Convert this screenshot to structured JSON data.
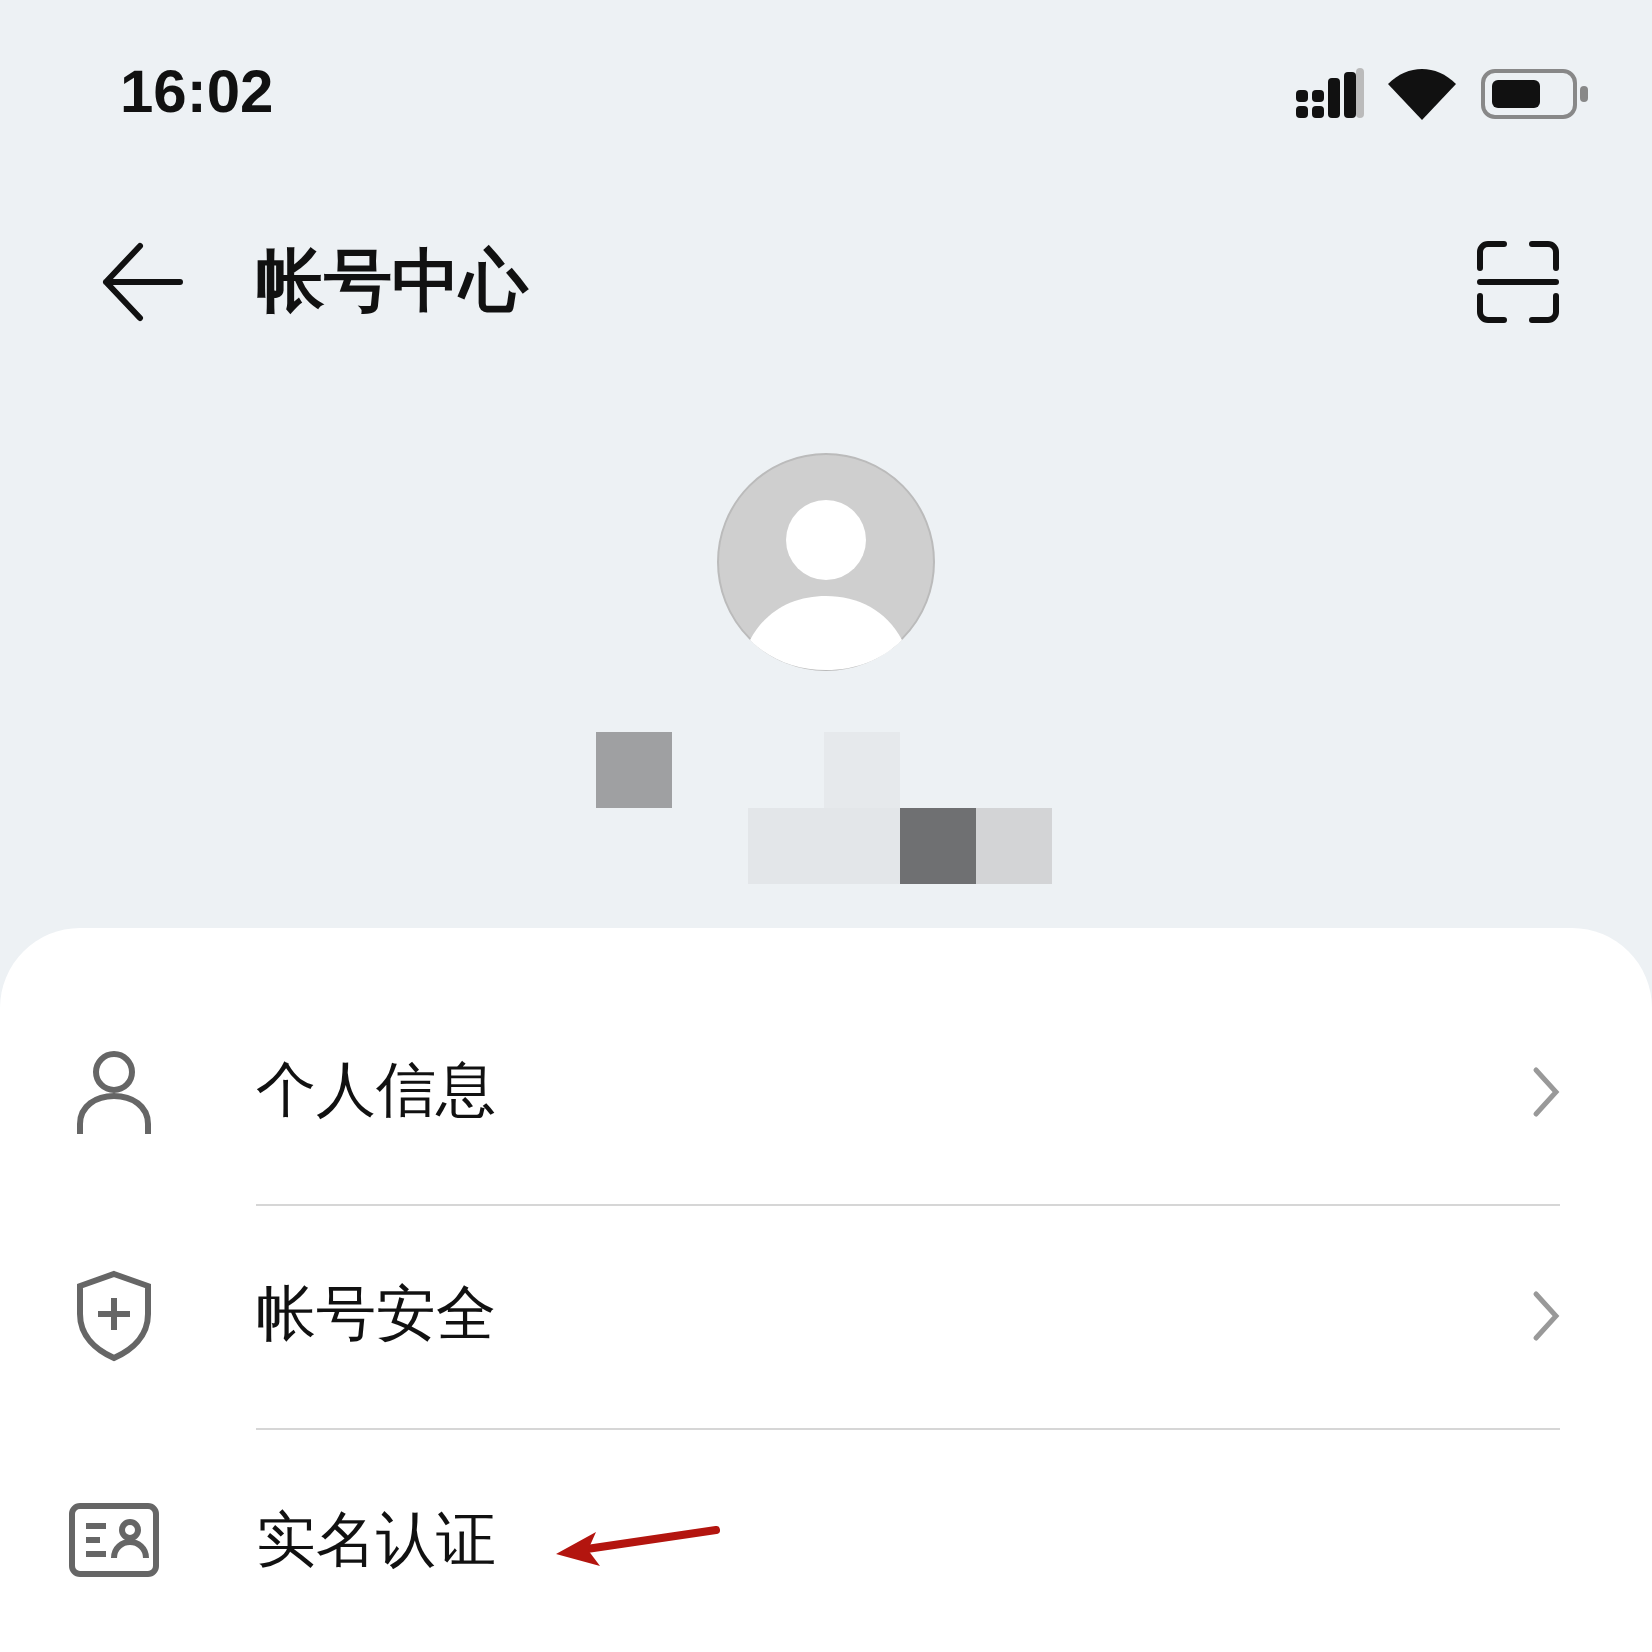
{
  "status_bar": {
    "time": "16:02"
  },
  "header": {
    "title": "帐号中心"
  },
  "menu": [
    {
      "kind": "person",
      "label": "个人信息",
      "chevron": true,
      "annotated": false
    },
    {
      "kind": "shield",
      "label": "帐号安全",
      "chevron": true,
      "annotated": false
    },
    {
      "kind": "idcard",
      "label": "实名认证",
      "chevron": false,
      "annotated": true
    }
  ]
}
